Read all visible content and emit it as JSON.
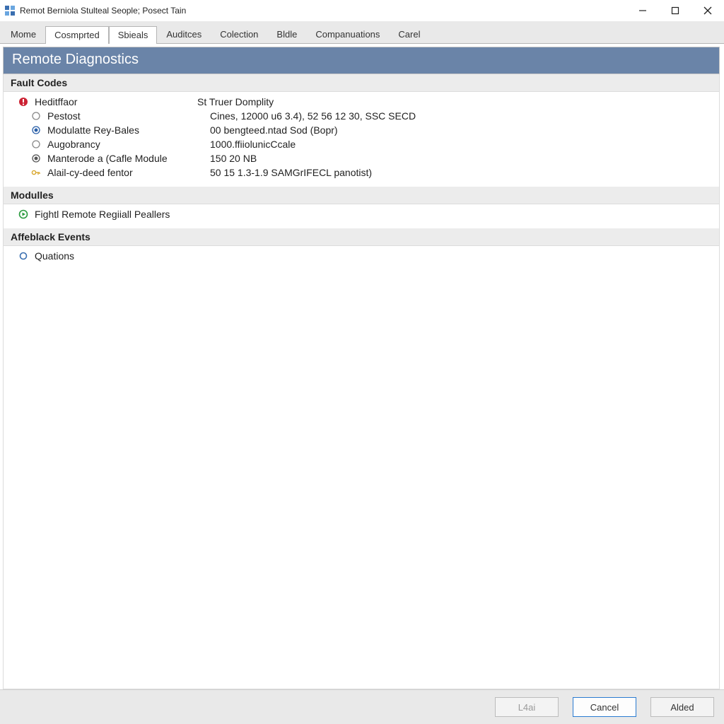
{
  "window": {
    "title": "Remot Berniola Stulteal Seople; Posect Tain"
  },
  "tabs": [
    {
      "label": "Mome",
      "active": false
    },
    {
      "label": "Cosmprted",
      "active": true
    },
    {
      "label": "Sbieals",
      "active": true
    },
    {
      "label": "Auditces",
      "active": false
    },
    {
      "label": "Colection",
      "active": false
    },
    {
      "label": "Bldle",
      "active": false
    },
    {
      "label": "Companuations",
      "active": false
    },
    {
      "label": "Carel",
      "active": false
    }
  ],
  "page_title": "Remote Diagnostics",
  "sections": {
    "fault_codes": {
      "header": "Fault Codes",
      "items": [
        {
          "icon": "error",
          "label": "Heditffaor",
          "value": "St Truer Domplity"
        },
        {
          "icon": "radio-off",
          "label": "Pestost",
          "value": "Cines, 12000 u6 3.4), 52 56 12 30, SSC SECD",
          "indent": true
        },
        {
          "icon": "radio-blue",
          "label": "Modulatte Rey-Bales",
          "value": "00 bengteed.ntad Sod (Bopr)",
          "indent": true
        },
        {
          "icon": "radio-off",
          "label": "Augobrancy",
          "value": "1000.ffiiolunicCcale",
          "indent": true
        },
        {
          "icon": "radio-dark",
          "label": "Manterode a (Cafle Module",
          "value": "150 20 NB",
          "indent": true
        },
        {
          "icon": "key",
          "label": "Alail-cy-deed fentor",
          "value": "50 15 1.3-1.9 SAMGrIFECL panotist)",
          "indent": true
        }
      ]
    },
    "modules": {
      "header": "Modulles",
      "items": [
        {
          "icon": "play-green",
          "label": "Fightl Remote Regiiall Peallers",
          "value": ""
        }
      ]
    },
    "events": {
      "header": "Affeblack Events",
      "items": [
        {
          "icon": "circle-open",
          "label": "Quations",
          "value": ""
        }
      ]
    }
  },
  "footer": {
    "ok_label": "L4ai",
    "cancel_label": "Cancel",
    "apply_label": "Alded"
  }
}
